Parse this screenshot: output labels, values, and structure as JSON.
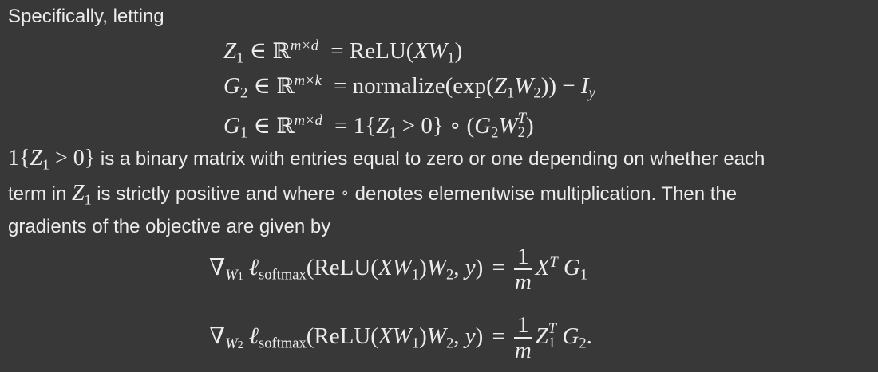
{
  "intro": "Specifically, letting",
  "definitions": {
    "z1": {
      "lhs_var": "Z",
      "lhs_sub": "1",
      "in": "∈",
      "space": "ℝ",
      "space_sup": "m×d",
      "eq": "=",
      "rhs_pre": "ReLU(",
      "rhs_var1": "XW",
      "rhs_sub1": "1",
      "rhs_post": ")"
    },
    "g2": {
      "lhs_var": "G",
      "lhs_sub": "2",
      "in": "∈",
      "space": "ℝ",
      "space_sup": "m×k",
      "eq": "=",
      "rhs_pre": "normalize(exp(",
      "rhs_var1": "Z",
      "rhs_sub1": "1",
      "rhs_var2": "W",
      "rhs_sub2": "2",
      "rhs_mid": ")) −",
      "rhs_var3": "I",
      "rhs_sub3": "y"
    },
    "g1": {
      "lhs_var": "G",
      "lhs_sub": "1",
      "in": "∈",
      "space": "ℝ",
      "space_sup": "m×d",
      "eq": "=",
      "rhs_pre": "1{",
      "rhs_var1": "Z",
      "rhs_sub1": "1",
      "rhs_mid": " > 0} ∘ (",
      "rhs_var2": "G",
      "rhs_sub2": "2",
      "rhs_var3": "W",
      "rhs_sub3": "2",
      "rhs_sup3": "T",
      "rhs_post": ")"
    }
  },
  "explanation": {
    "line1_math_pre": "1{",
    "line1_math_var": "Z",
    "line1_math_sub": "1",
    "line1_math_post": " > 0}",
    "line1_text": " is a binary matrix with entries equal to zero or one depending on whether each",
    "line2_pre": "term in ",
    "line2_var": "Z",
    "line2_sub": "1",
    "line2_mid": " is strictly positive and where ",
    "line2_circ": "∘",
    "line2_post": " denotes elementwise multiplication. Then the",
    "line3": "gradients of the objective are given by"
  },
  "gradients": {
    "w1": {
      "nabla": "∇",
      "nabla_sub_var": "W",
      "nabla_sub_sub": "1",
      "ell": "ℓ",
      "ell_sub": "softmax",
      "arg_pre": "(ReLU(",
      "arg_var1": "XW",
      "arg_sub1": "1",
      "arg_mid": ")",
      "arg_var2": "W",
      "arg_sub2": "2",
      "arg_post": ", ",
      "arg_y": "y",
      "arg_close": ")",
      "eq": "=",
      "frac_num": "1",
      "frac_den": "m",
      "rhs_var1": "X",
      "rhs_sup1": "T",
      "rhs_var2": "G",
      "rhs_sub2": "1",
      "trail": ""
    },
    "w2": {
      "nabla": "∇",
      "nabla_sub_var": "W",
      "nabla_sub_sub": "2",
      "ell": "ℓ",
      "ell_sub": "softmax",
      "arg_pre": "(ReLU(",
      "arg_var1": "XW",
      "arg_sub1": "1",
      "arg_mid": ")",
      "arg_var2": "W",
      "arg_sub2": "2",
      "arg_post": ", ",
      "arg_y": "y",
      "arg_close": ")",
      "eq": "=",
      "frac_num": "1",
      "frac_den": "m",
      "rhs_var1": "Z",
      "rhs_sub1": "1",
      "rhs_sup1": "T",
      "rhs_var2": "G",
      "rhs_sub2": "2",
      "trail": "."
    }
  }
}
